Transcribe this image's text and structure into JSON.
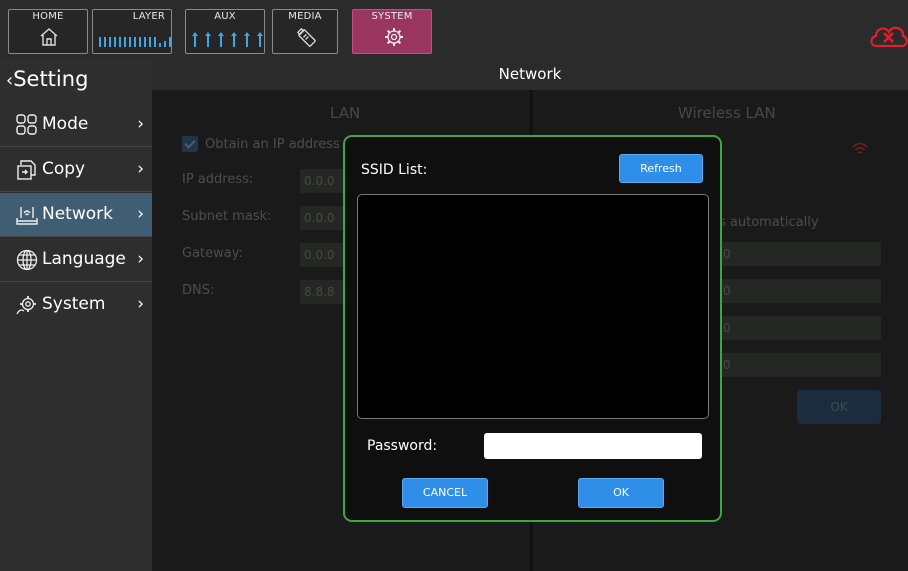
{
  "topbar": {
    "tabs": [
      {
        "label": "HOME",
        "icon": "home-icon"
      },
      {
        "label": "LAYER",
        "icon": "meter-bars-icon"
      },
      {
        "label": "AUX",
        "icon": "aux-bars-icon"
      },
      {
        "label": "MEDIA",
        "icon": "usb-drive-icon"
      },
      {
        "label": "SYSTEM",
        "icon": "gear-icon",
        "active": true
      }
    ],
    "status_icon": "cloud-disconnected-icon",
    "colors": {
      "active_tab": "#9a3560",
      "meter": "#3fa6e6",
      "alert": "#e0202a"
    }
  },
  "sidebar": {
    "title": "Setting",
    "back_icon": "chevron-left-icon",
    "items": [
      {
        "label": "Mode",
        "icon": "grid-icon",
        "chevron": "›"
      },
      {
        "label": "Copy",
        "icon": "copy-icon",
        "chevron": "›"
      },
      {
        "label": "Network",
        "icon": "router-icon",
        "chevron": "›",
        "active": true
      },
      {
        "label": "Language",
        "icon": "globe-icon",
        "chevron": "›"
      },
      {
        "label": "System",
        "icon": "gear-icon",
        "chevron": "›"
      }
    ]
  },
  "main": {
    "header": "Network",
    "lan": {
      "title": "LAN",
      "obtain_label": "Obtain an IP address",
      "ip_label": "IP address:",
      "ip_value": "0.0.0",
      "subnet_label": "Subnet mask:",
      "subnet_value": "0.0.0",
      "gateway_label": "Gateway:",
      "gateway_value": "0.0.0",
      "dns_label": "DNS:",
      "dns_value": "8.8.8"
    },
    "wlan": {
      "title": "Wireless LAN",
      "auto_label": "s automatically",
      "ok_label": "OK",
      "field1": "0",
      "field2": "0",
      "field3": "0",
      "field4": "0"
    }
  },
  "dialog": {
    "ssid_label": "SSID List:",
    "refresh_label": "Refresh",
    "password_label": "Password:",
    "password_value": "",
    "cancel_label": "CANCEL",
    "ok_label": "OK",
    "border_color": "#3ea641",
    "button_color": "#2f8fe8"
  }
}
